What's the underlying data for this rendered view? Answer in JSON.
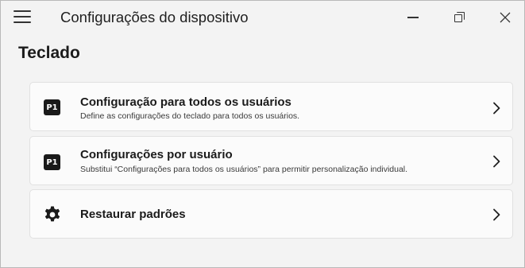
{
  "window": {
    "title": "Configurações do dispositivo"
  },
  "page": {
    "title": "Teclado"
  },
  "cards": [
    {
      "icon": "p1-badge-icon",
      "badge": "P1",
      "heading": "Configuração para todos os usuários",
      "description": "Define as configurações do teclado para todos os usuários."
    },
    {
      "icon": "p1-badge-icon",
      "badge": "P1",
      "heading": "Configurações por usuário",
      "description": "Substitui “Configurações para todos os usuários” para permitir personalização individual."
    },
    {
      "icon": "gear-icon",
      "heading": "Restaurar padrões"
    }
  ]
}
